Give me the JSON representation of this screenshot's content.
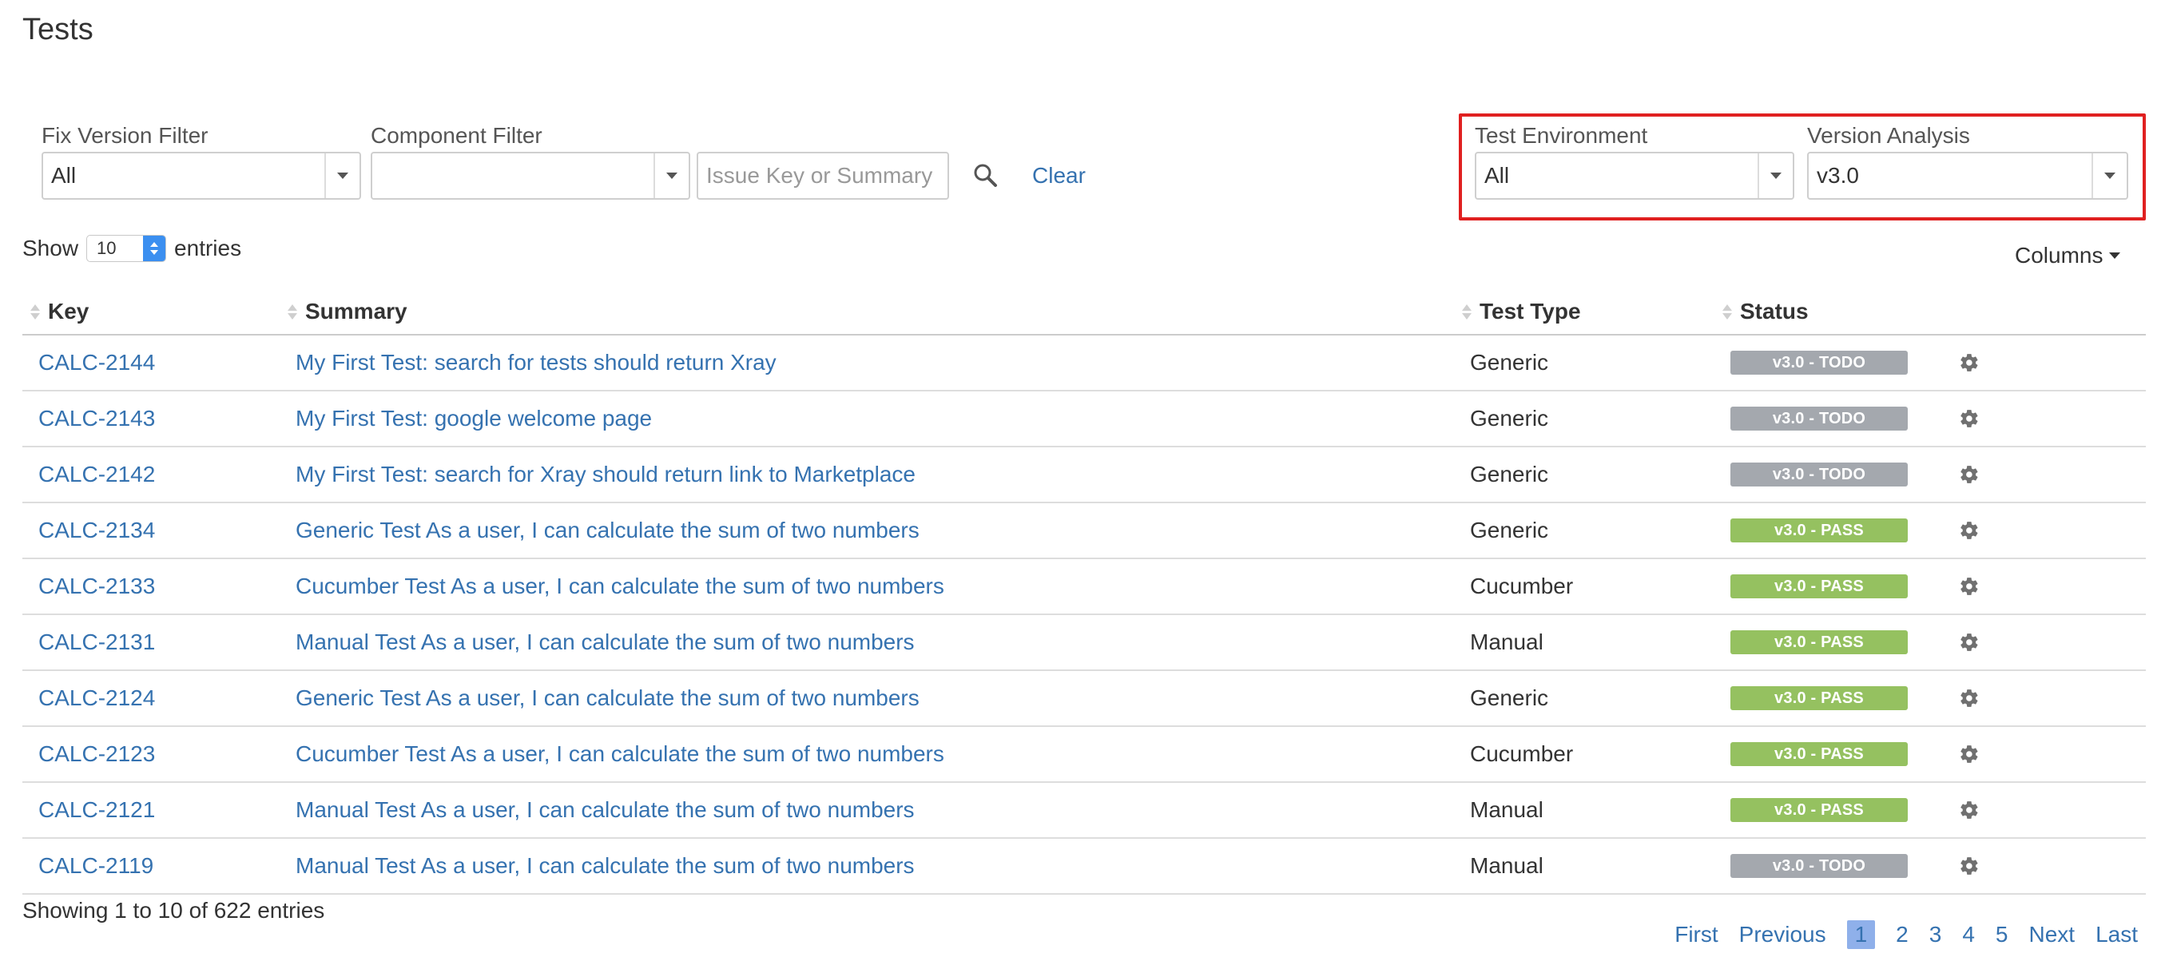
{
  "page": {
    "title": "Tests"
  },
  "filters": {
    "fix_version": {
      "label": "Fix Version Filter",
      "value": "All"
    },
    "component": {
      "label": "Component Filter",
      "value": ""
    },
    "search": {
      "placeholder": "Issue Key or Summary",
      "value": ""
    },
    "clear_label": "Clear",
    "test_environment": {
      "label": "Test Environment",
      "value": "All"
    },
    "version_analysis": {
      "label": "Version Analysis",
      "value": "v3.0"
    }
  },
  "highlight": {
    "color": "#e02020"
  },
  "length_menu": {
    "prefix": "Show",
    "value": "10",
    "suffix": "entries"
  },
  "columns_button": {
    "label": "Columns"
  },
  "table": {
    "headers": {
      "key": "Key",
      "summary": "Summary",
      "test_type": "Test Type",
      "status": "Status"
    },
    "rows": [
      {
        "key": "CALC-2144",
        "summary": "My First Test: search for tests should return Xray",
        "test_type": "Generic",
        "status": "v3.0 - TODO",
        "status_kind": "todo"
      },
      {
        "key": "CALC-2143",
        "summary": "My First Test: google welcome page",
        "test_type": "Generic",
        "status": "v3.0 - TODO",
        "status_kind": "todo"
      },
      {
        "key": "CALC-2142",
        "summary": "My First Test: search for Xray should return link to Marketplace",
        "test_type": "Generic",
        "status": "v3.0 - TODO",
        "status_kind": "todo"
      },
      {
        "key": "CALC-2134",
        "summary": "Generic Test As a user, I can calculate the sum of two numbers",
        "test_type": "Generic",
        "status": "v3.0 - PASS",
        "status_kind": "pass"
      },
      {
        "key": "CALC-2133",
        "summary": "Cucumber Test As a user, I can calculate the sum of two numbers",
        "test_type": "Cucumber",
        "status": "v3.0 - PASS",
        "status_kind": "pass"
      },
      {
        "key": "CALC-2131",
        "summary": "Manual Test As a user, I can calculate the sum of two numbers",
        "test_type": "Manual",
        "status": "v3.0 - PASS",
        "status_kind": "pass"
      },
      {
        "key": "CALC-2124",
        "summary": "Generic Test As a user, I can calculate the sum of two numbers",
        "test_type": "Generic",
        "status": "v3.0 - PASS",
        "status_kind": "pass"
      },
      {
        "key": "CALC-2123",
        "summary": "Cucumber Test As a user, I can calculate the sum of two numbers",
        "test_type": "Cucumber",
        "status": "v3.0 - PASS",
        "status_kind": "pass"
      },
      {
        "key": "CALC-2121",
        "summary": "Manual Test As a user, I can calculate the sum of two numbers",
        "test_type": "Manual",
        "status": "v3.0 - PASS",
        "status_kind": "pass"
      },
      {
        "key": "CALC-2119",
        "summary": "Manual Test As a user, I can calculate the sum of two numbers",
        "test_type": "Manual",
        "status": "v3.0 - TODO",
        "status_kind": "todo"
      }
    ]
  },
  "footer": {
    "info": "Showing 1 to 10 of 622 entries"
  },
  "pagination": {
    "first": "First",
    "previous": "Previous",
    "pages": [
      "1",
      "2",
      "3",
      "4",
      "5"
    ],
    "current_page": "1",
    "next": "Next",
    "last": "Last"
  },
  "colors": {
    "link": "#3572b0",
    "todo": "#a4a8ae",
    "pass": "#95c160",
    "current_page_bg": "#8fb0ea"
  },
  "icons": {
    "search": "search-icon",
    "gear": "gear-icon",
    "dropdown": "chevron-down-icon"
  }
}
